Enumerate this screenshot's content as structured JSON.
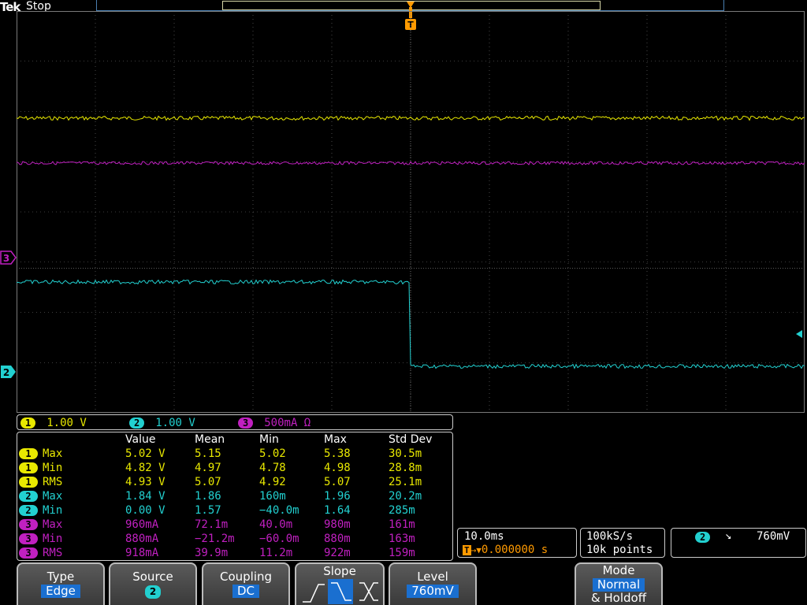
{
  "header": {
    "brand": "Tek",
    "status": "Stop"
  },
  "trigger_marker": "T",
  "channels": [
    {
      "id": "1",
      "scale": "1.00 V",
      "color": "#e8e800"
    },
    {
      "id": "2",
      "scale": "1.00 V",
      "color": "#22d0d0"
    },
    {
      "id": "3",
      "scale": "500mA Ω",
      "color": "#c020c0"
    }
  ],
  "ground_markers": {
    "ch3": "3",
    "ch2": "2"
  },
  "measurements": {
    "headers": [
      "Value",
      "Mean",
      "Min",
      "Max",
      "Std Dev"
    ],
    "rows": [
      {
        "ch": "1",
        "type": "Max",
        "value": "5.02 V",
        "mean": "5.15",
        "min": "5.02",
        "max": "5.38",
        "std": "30.5m"
      },
      {
        "ch": "1",
        "type": "Min",
        "value": "4.82 V",
        "mean": "4.97",
        "min": "4.78",
        "max": "4.98",
        "std": "28.8m"
      },
      {
        "ch": "1",
        "type": "RMS",
        "value": "4.93 V",
        "mean": "5.07",
        "min": "4.92",
        "max": "5.07",
        "std": "25.1m"
      },
      {
        "ch": "2",
        "type": "Max",
        "value": "1.84 V",
        "mean": "1.86",
        "min": "160m",
        "max": "1.96",
        "std": "20.2m"
      },
      {
        "ch": "2",
        "type": "Min",
        "value": "0.00 V",
        "mean": "1.57",
        "min": "−40.0m",
        "max": "1.64",
        "std": "285m"
      },
      {
        "ch": "3",
        "type": "Max",
        "value": "960mA",
        "mean": "72.1m",
        "min": "40.0m",
        "max": "980m",
        "std": "161m"
      },
      {
        "ch": "3",
        "type": "Min",
        "value": "880mA",
        "mean": "−21.2m",
        "min": "−60.0m",
        "max": "880m",
        "std": "163m"
      },
      {
        "ch": "3",
        "type": "RMS",
        "value": "918mA",
        "mean": "39.9m",
        "min": "11.2m",
        "max": "922m",
        "std": "159m"
      }
    ]
  },
  "timebase": {
    "scale": "10.0ms",
    "trigger_pos": "0.000000 s",
    "trig_icon": "T",
    "arrow": "→▼"
  },
  "acquisition": {
    "rate": "100kS/s",
    "points": "10k points"
  },
  "trigger_readout": {
    "source": "2",
    "slope_symbol": "↘",
    "level": "760mV"
  },
  "softkeys": {
    "type": {
      "label": "Type",
      "value": "Edge"
    },
    "source": {
      "label": "Source",
      "value": "2"
    },
    "coupling": {
      "label": "Coupling",
      "value": "DC"
    },
    "slope": {
      "label": "Slope",
      "options": [
        "rising",
        "falling",
        "either"
      ],
      "selected": "falling"
    },
    "level": {
      "label": "Level",
      "value": "760mV"
    },
    "mode": {
      "label": "Mode",
      "value": "Normal",
      "sub": "& Holdoff"
    }
  },
  "colors": {
    "ch1": "#e8e800",
    "ch2": "#22d0d0",
    "ch3": "#c020c0",
    "trigger": "#ff9a00",
    "grid": "#7a7a7a"
  }
}
